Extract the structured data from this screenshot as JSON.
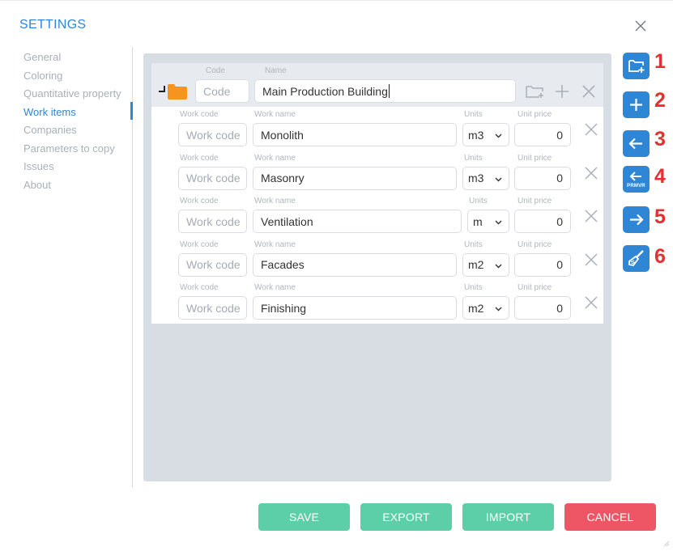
{
  "window": {
    "title": "SETTINGS"
  },
  "sidebar": {
    "items": [
      {
        "label": "General",
        "active": false
      },
      {
        "label": "Coloring",
        "active": false
      },
      {
        "label": "Quantitative property",
        "active": false
      },
      {
        "label": "Work items",
        "active": true
      },
      {
        "label": "Companies",
        "active": false
      },
      {
        "label": "Parameters to copy",
        "active": false
      },
      {
        "label": "Issues",
        "active": false
      },
      {
        "label": "About",
        "active": false
      }
    ]
  },
  "group": {
    "code_label": "Code",
    "name_label": "Name",
    "code_placeholder": "Code",
    "name_value": "Main Production Building"
  },
  "row_labels": {
    "work_code": "Work code",
    "work_name": "Work name",
    "units": "Units",
    "unit_price": "Unit price"
  },
  "work_items": [
    {
      "code_placeholder": "Work code",
      "name": "Monolith",
      "units": "m3",
      "price": "0"
    },
    {
      "code_placeholder": "Work code",
      "name": "Masonry",
      "units": "m3",
      "price": "0"
    },
    {
      "code_placeholder": "Work code",
      "name": "Ventilation",
      "units": "m",
      "price": "0"
    },
    {
      "code_placeholder": "Work code",
      "name": "Facades",
      "units": "m2",
      "price": "0"
    },
    {
      "code_placeholder": "Work code",
      "name": "Finishing",
      "units": "m2",
      "price": "0"
    }
  ],
  "tools": [
    {
      "number": "1",
      "icon": "add-folder-icon"
    },
    {
      "number": "2",
      "icon": "plus-icon"
    },
    {
      "number": "3",
      "icon": "arrow-left-icon"
    },
    {
      "number": "4",
      "icon": "arrow-left-prmvr-icon",
      "sub_label": "PRMVR"
    },
    {
      "number": "5",
      "icon": "arrow-right-icon"
    },
    {
      "number": "6",
      "icon": "brush-icon"
    }
  ],
  "buttons": {
    "save": "SAVE",
    "export": "EXPORT",
    "import": "IMPORT",
    "cancel": "CANCEL"
  },
  "colors": {
    "accent": "#2f86d4",
    "save": "#5ccfa8",
    "cancel": "#ee5665",
    "annotation": "#e33030",
    "folder": "#f7941d"
  }
}
